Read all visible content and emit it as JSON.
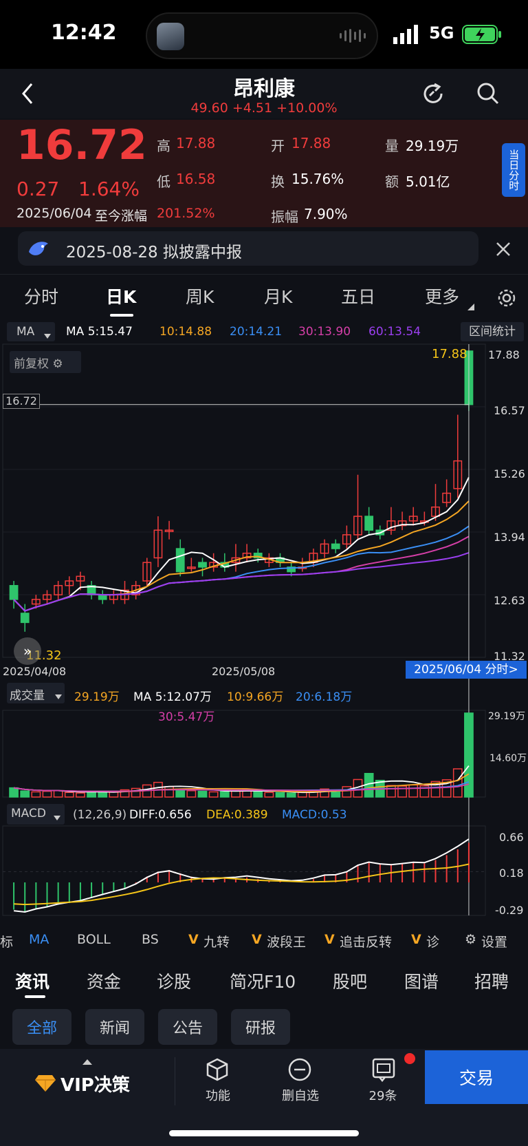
{
  "status_bar": {
    "time": "12:42",
    "network": "5G"
  },
  "header": {
    "title": "昂利康",
    "sub": "49.60 +4.51 +10.00%",
    "back_icon": "chevron-left-icon",
    "refresh_icon": "refresh-icon",
    "search_icon": "search-icon"
  },
  "quote": {
    "price": "16.72",
    "change": "0.27",
    "change_pct": "1.64%",
    "date": "2025/06/04",
    "since_label": "至今涨幅",
    "since_val": "201.52%",
    "high_label": "高",
    "high": "17.88",
    "low_label": "低",
    "low": "16.58",
    "open_label": "开",
    "open": "17.88",
    "turnover_label": "换",
    "turnover": "15.76%",
    "amplitude_label": "振幅",
    "amplitude": "7.90%",
    "volume_label": "量",
    "volume": "29.19万",
    "amount_label": "额",
    "amount": "5.01亿",
    "intraday_badge": "当日分时"
  },
  "notice": {
    "text": "2025-08-28 拟披露中报",
    "close_icon": "close-icon",
    "logo_icon": "dolphin-logo-icon"
  },
  "period_tabs": [
    "分时",
    "日K",
    "周K",
    "月K",
    "五日",
    "更多"
  ],
  "active_period": "日K",
  "main_legend": {
    "ma_select": "MA",
    "ma5": "MA 5:15.47",
    "ma10": "10:14.88",
    "ma20": "20:14.21",
    "ma30": "30:13.90",
    "ma60": "60:13.54",
    "range_stats": "区间统计",
    "adjust": "前复权"
  },
  "axis": {
    "y_labels": [
      "17.88",
      "16.57",
      "15.26",
      "13.94",
      "12.63",
      "11.32"
    ],
    "x_start": "2025/04/08",
    "x_mid": "2025/05/08",
    "crosshair_price": "16.72",
    "crosshair_date": "2025/06/04 分时>",
    "max_label": "17.88",
    "min_label": "11.32"
  },
  "volume_legend": {
    "select": "成交量",
    "current": "29.19万",
    "ma5": "MA 5:12.07万",
    "ma10": "10:9.66万",
    "ma20": "20:6.18万",
    "ma30": "30:5.47万",
    "y_top": "29.19万",
    "y_mid": "14.60万"
  },
  "macd_legend": {
    "select": "MACD",
    "params": "(12,26,9)",
    "diff": "DIFF:0.656",
    "dea": "DEA:0.389",
    "macd": "MACD:0.53",
    "y_labels": [
      "0.66",
      "0.18",
      "-0.29"
    ]
  },
  "indicators": [
    "标",
    "MA",
    "BOLL",
    "BS",
    "九转",
    "波段王",
    "追击反转",
    "诊",
    "设置"
  ],
  "section_tabs": [
    "资讯",
    "资金",
    "诊股",
    "简况F10",
    "股吧",
    "图谱",
    "招聘"
  ],
  "filter_pills": [
    "全部",
    "新闻",
    "公告",
    "研报"
  ],
  "bottom_bar": {
    "vip": "VIP决策",
    "func": "功能",
    "remove": "删自选",
    "count": "29条",
    "trade": "交易"
  },
  "colors": {
    "up": "#f03c3c",
    "down": "#2fc46b",
    "ma5": "#ffffff",
    "ma10": "#f5a623",
    "ma20": "#3a8ff5",
    "ma30": "#d63fa8",
    "ma60": "#9b3ff0"
  },
  "chart_data": {
    "type": "candlestick",
    "x_range": [
      "2025/04/08",
      "2025/06/04"
    ],
    "y_range": [
      11.32,
      17.88
    ],
    "candles": [
      [
        12.8,
        12.5,
        12.9,
        12.3
      ],
      [
        12.2,
        12.0,
        12.4,
        11.8
      ],
      [
        12.4,
        12.5,
        12.6,
        12.3
      ],
      [
        12.5,
        12.6,
        12.7,
        12.4
      ],
      [
        12.6,
        12.8,
        12.9,
        12.5
      ],
      [
        12.8,
        12.9,
        13.0,
        12.6
      ],
      [
        12.9,
        13.0,
        13.1,
        12.7
      ],
      [
        12.8,
        12.6,
        12.9,
        12.5
      ],
      [
        12.6,
        12.5,
        12.7,
        12.4
      ],
      [
        12.5,
        12.6,
        12.7,
        12.4
      ],
      [
        12.5,
        12.7,
        12.9,
        12.4
      ],
      [
        12.6,
        12.8,
        12.9,
        12.5
      ],
      [
        12.9,
        13.3,
        13.4,
        12.8
      ],
      [
        13.4,
        14.0,
        14.3,
        13.2
      ],
      [
        14.0,
        14.0,
        14.2,
        13.8
      ],
      [
        13.6,
        13.1,
        13.8,
        13.0
      ],
      [
        13.2,
        13.2,
        13.4,
        13.1
      ],
      [
        13.3,
        13.2,
        13.4,
        13.0
      ],
      [
        13.2,
        13.3,
        13.5,
        13.1
      ],
      [
        13.3,
        13.2,
        13.5,
        13.1
      ],
      [
        13.3,
        13.4,
        13.7,
        13.1
      ],
      [
        13.4,
        13.5,
        13.7,
        13.3
      ],
      [
        13.5,
        13.4,
        13.6,
        13.3
      ],
      [
        13.3,
        13.4,
        13.5,
        13.2
      ],
      [
        13.4,
        13.3,
        13.5,
        13.2
      ],
      [
        13.2,
        13.1,
        13.3,
        13.0
      ],
      [
        13.2,
        13.2,
        13.4,
        13.1
      ],
      [
        13.3,
        13.5,
        13.6,
        13.2
      ],
      [
        13.5,
        13.7,
        13.8,
        13.4
      ],
      [
        13.7,
        13.6,
        13.8,
        13.5
      ],
      [
        13.7,
        13.9,
        14.1,
        13.6
      ],
      [
        13.9,
        14.3,
        15.2,
        13.8
      ],
      [
        14.3,
        14.0,
        14.5,
        13.9
      ],
      [
        14.0,
        13.9,
        14.1,
        13.8
      ],
      [
        14.0,
        14.2,
        14.5,
        13.9
      ],
      [
        14.1,
        14.2,
        14.4,
        14.0
      ],
      [
        14.2,
        14.3,
        14.5,
        14.1
      ],
      [
        14.2,
        14.2,
        14.4,
        14.1
      ],
      [
        14.3,
        14.5,
        15.0,
        14.2
      ],
      [
        14.6,
        14.8,
        15.1,
        14.5
      ],
      [
        14.9,
        15.5,
        16.5,
        14.7
      ],
      [
        17.88,
        16.72,
        17.88,
        16.58
      ]
    ],
    "volume": [
      3.2,
      2.1,
      1.8,
      2.0,
      2.2,
      1.6,
      1.4,
      1.8,
      2.0,
      1.7,
      2.5,
      3.0,
      4.2,
      5.1,
      3.6,
      2.8,
      2.2,
      2.0,
      1.8,
      1.9,
      2.4,
      2.6,
      2.0,
      1.6,
      1.5,
      1.4,
      1.6,
      2.2,
      2.8,
      2.4,
      3.6,
      6.1,
      8.2,
      5.8,
      4.0,
      3.8,
      4.2,
      3.9,
      5.4,
      6.0,
      9.8,
      29.19
    ],
    "macd": [
      -0.28,
      -0.3,
      -0.27,
      -0.25,
      -0.22,
      -0.2,
      -0.18,
      -0.14,
      -0.1,
      -0.06,
      -0.02,
      0.04,
      0.12,
      0.18,
      0.2,
      0.16,
      0.12,
      0.1,
      0.09,
      0.1,
      0.1,
      0.11,
      0.09,
      0.07,
      0.06,
      0.05,
      0.06,
      0.09,
      0.13,
      0.14,
      0.18,
      0.26,
      0.3,
      0.28,
      0.27,
      0.28,
      0.29,
      0.28,
      0.32,
      0.38,
      0.45,
      0.53
    ]
  }
}
